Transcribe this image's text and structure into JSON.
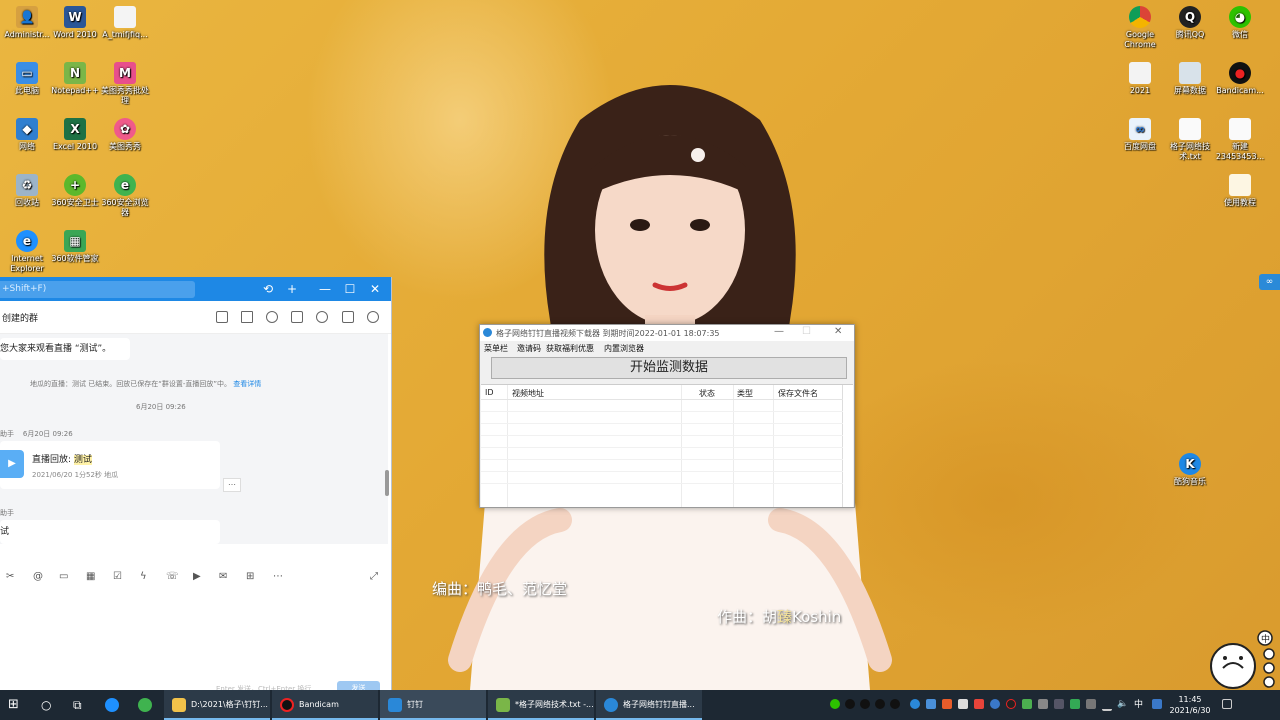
{
  "desktop_icons": {
    "administrator": "Administr...",
    "word2010": "Word 2010",
    "a_file": "A_tmifjfiq...",
    "this_pc": "此电脑",
    "notepadpp": "Notepad++",
    "prop1": "美图秀秀批处理",
    "network": "网络",
    "excel2010": "Excel 2010",
    "meitu": "美图秀秀",
    "recycle": "回收站",
    "guard360": "360安全卫士",
    "browser360": "360安全浏览器",
    "ie": "Internet Explorer",
    "soft360": "360软件管家",
    "chrome": "Google Chrome",
    "qq": "腾讯QQ",
    "wechat": "微信",
    "folder2021": "2021",
    "screen_data": "屏幕数据",
    "bandicam": "Bandicam...",
    "baidu_pan": "百度网盘",
    "gezi_tech": "格子网络技术.txt",
    "new_file": "新建 23453453...",
    "tutorial": "使用教程",
    "kugou": "酷狗音乐"
  },
  "dingtalk": {
    "search_placeholder": "+Shift+F)",
    "window_controls": {
      "history": "⟲",
      "add": "+",
      "min": "—",
      "max": "☐",
      "close": "✕"
    },
    "chat_title": "创建的群",
    "msg_invite": "您大家来观看直播 “测试”。",
    "sys_msg": "地瓜的直播：测试 已结束。回放已保存在“群设置-直播回放”中。",
    "sys_link": "查看详情",
    "date1": "6月20日 09:26",
    "sender_prefix": "助手",
    "date2": "6月20日 09:26",
    "card_title_prefix": "直播回放: ",
    "card_title_hl": "测试",
    "card_meta": "2021/06/20   1分52秒   地瓜",
    "more": "…",
    "sender2": "助手",
    "partial": "试",
    "send_hint": "Enter 发送，Ctrl+Enter 换行",
    "send": "发送"
  },
  "downloader": {
    "title": "格子网络钉钉直播视频下载器   到期时间2022-01-01 18:07:35",
    "menu": [
      "菜单栏",
      "邀请码",
      "获取福利优惠",
      "内置浏览器"
    ],
    "start_button": "开始监测数据",
    "columns": [
      "ID",
      "视频地址",
      "状态",
      "类型",
      "保存文件名"
    ]
  },
  "lyrics": {
    "line1": "编曲：鸭毛、范忆堂",
    "line2_prefix": "作曲：胡",
    "line2_hl": "臻",
    "line2_rest": "Koshin"
  },
  "taskbar": {
    "items": [
      "D:\\2021\\格子\\钉钉...",
      "Bandicam",
      "钉钉",
      "*格子网络技术.txt -...",
      "格子网络钉钉直播..."
    ],
    "time": "11:45",
    "date": "2021/6/30",
    "ime": "中"
  },
  "colors": {
    "accent": "#1e88e5",
    "taskbar": "#1d2833",
    "wallpaper": "#e4ae3c"
  }
}
